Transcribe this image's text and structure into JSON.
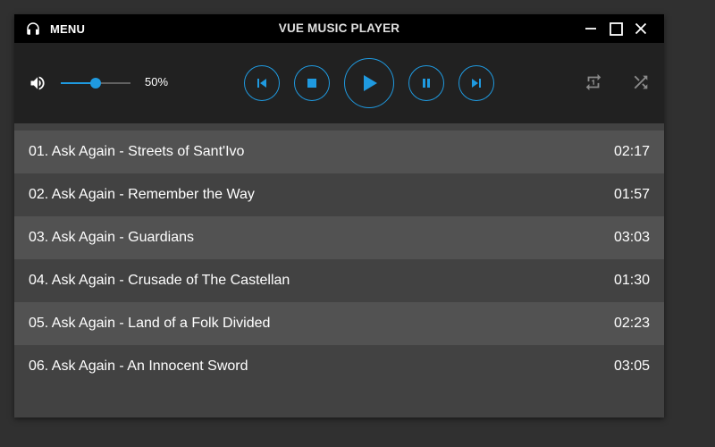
{
  "titlebar": {
    "menu_label": "MENU",
    "app_title": "VUE MUSIC PLAYER",
    "icons": {
      "menu": "headphones-icon",
      "minimize": "minimize-icon",
      "maximize": "maximize-icon",
      "close": "close-icon"
    }
  },
  "controls": {
    "volume_value": 0.5,
    "volume_label": "50%",
    "icons": {
      "volume": "volume-icon",
      "previous": "skip-previous-icon",
      "stop": "stop-icon",
      "play": "play-icon",
      "pause": "pause-icon",
      "next": "skip-next-icon",
      "repeat": "repeat-one-icon",
      "shuffle": "shuffle-icon"
    }
  },
  "playlist": {
    "tracks": [
      {
        "title": "01. Ask Again - Streets of Sant'Ivo",
        "duration": "02:17"
      },
      {
        "title": "02. Ask Again - Remember the Way",
        "duration": "01:57"
      },
      {
        "title": "03. Ask Again - Guardians",
        "duration": "03:03"
      },
      {
        "title": "04. Ask Again - Crusade of The Castellan",
        "duration": "01:30"
      },
      {
        "title": "05. Ask Again - Land of a Folk Divided",
        "duration": "02:23"
      },
      {
        "title": "06. Ask Again - An Innocent Sword",
        "duration": "03:05"
      }
    ]
  },
  "colors": {
    "accent": "#1f9ae0",
    "titlebar_bg": "#000000",
    "controls_bg": "#212121",
    "row_light": "#525252",
    "row_dark": "#424242",
    "page_bg": "#303030"
  }
}
